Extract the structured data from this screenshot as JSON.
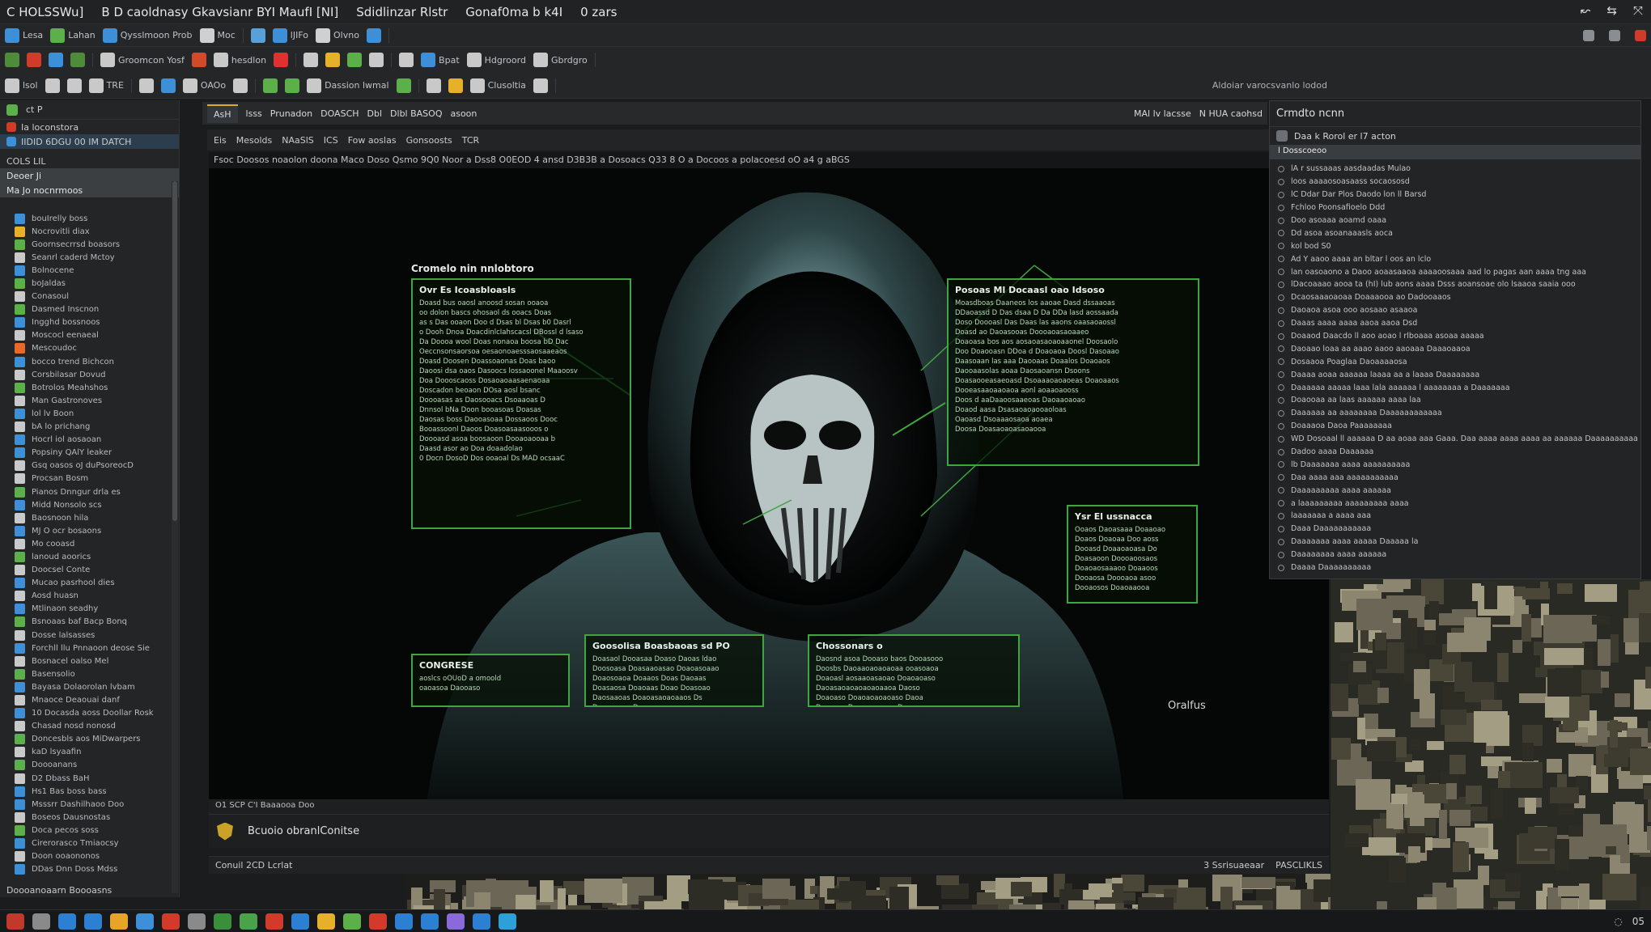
{
  "window": {
    "titles": [
      "C HOLSSWu]",
      "B D caoldnasy Gkavsianr BYI MaufI [NI]",
      "Sdidlinzar Rlstr",
      "Gonaf0ma b k4I",
      "0 zars"
    ],
    "controls": [
      "↜",
      "⇆",
      "⤧"
    ]
  },
  "toolbar1": {
    "items": [
      {
        "label": "Lesa",
        "icon": "file-icon",
        "color": "#3d8fd8"
      },
      {
        "label": "Lahan",
        "icon": "edit-icon",
        "color": "#5bb04a"
      },
      {
        "label": "Qysslmoon Prob",
        "icon": "view-icon",
        "color": "#3d8fd8"
      },
      {
        "label": "Moc",
        "icon": "insert-icon",
        "color": "#d0d0d0"
      },
      {
        "label": "",
        "icon": "format-icon",
        "color": "#5aa0d8"
      },
      {
        "label": "lJIFo",
        "icon": "tools-icon",
        "color": "#3d8fd8"
      },
      {
        "label": "Olvno",
        "icon": "window-icon",
        "color": "#d0d0d0"
      },
      {
        "label": "",
        "icon": "help-icon",
        "color": "#3d8fd8"
      }
    ],
    "right_icons": [
      "monitor-icon",
      "person-icon",
      "warning-icon"
    ]
  },
  "toolbar2": {
    "items": [
      {
        "label": "",
        "icon": "new-icon",
        "color": "#4f8c3a"
      },
      {
        "label": "",
        "icon": "open-icon",
        "color": "#d23a2a"
      },
      {
        "label": "",
        "icon": "save-icon",
        "color": "#3d8fd8"
      },
      {
        "label": "",
        "icon": "tag-icon",
        "color": "#4f8c3a"
      },
      {
        "label": "Groomcon Yosf",
        "icon": "cursor-icon",
        "color": "#c9c9c9"
      },
      {
        "label": "",
        "icon": "brush-icon",
        "color": "#d24a2a"
      },
      {
        "label": "hesdlon",
        "icon": "hand-icon",
        "color": "#c9c9c9"
      },
      {
        "label": "",
        "icon": "record-icon",
        "color": "#e03030"
      },
      {
        "label": "",
        "icon": "zoom-icon",
        "color": "#c9c9c9"
      },
      {
        "label": "",
        "icon": "folder-icon",
        "color": "#e6b02a"
      },
      {
        "label": "",
        "icon": "leaf-icon",
        "color": "#5bb04a"
      },
      {
        "label": "",
        "icon": "line-icon",
        "color": "#c9c9c9"
      },
      {
        "label": "",
        "icon": "compass-icon",
        "color": "#c9c9c9"
      },
      {
        "label": "Bpat",
        "icon": "grid-icon",
        "color": "#3d8fd8"
      },
      {
        "label": "Hdgroord",
        "icon": "layers-icon",
        "color": "#c9c9c9"
      },
      {
        "label": "Gbrdgro",
        "icon": "layers2-icon",
        "color": "#c9c9c9"
      }
    ]
  },
  "toolbar3": {
    "items": [
      {
        "label": "lsol",
        "icon": "gear-icon",
        "color": "#c9c9c9"
      },
      {
        "label": "",
        "icon": "refresh-icon",
        "color": "#c9c9c9"
      },
      {
        "label": "",
        "icon": "frame-icon",
        "color": "#c9c9c9"
      },
      {
        "label": "TRE",
        "icon": "text-icon",
        "color": "#c9c9c9"
      },
      {
        "label": "",
        "icon": "flask-icon",
        "color": "#c9c9c9"
      },
      {
        "label": "",
        "icon": "image-icon",
        "color": "#3d8fd8"
      },
      {
        "label": "OAOo",
        "icon": "shapes-icon",
        "color": "#c9c9c9"
      },
      {
        "label": "",
        "icon": "arrow-icon",
        "color": "#c9c9c9"
      },
      {
        "label": "",
        "icon": "filter-icon",
        "color": "#5bb04a"
      },
      {
        "label": "",
        "icon": "triangle-icon",
        "color": "#5bb04a"
      },
      {
        "label": "Dassion lwmal",
        "icon": "cube-icon",
        "color": "#c9c9c9"
      },
      {
        "label": "",
        "icon": "globe-icon",
        "color": "#5bb04a"
      },
      {
        "label": "",
        "icon": "pin-icon",
        "color": "#c9c9c9"
      },
      {
        "label": "",
        "icon": "chart-icon",
        "color": "#e6b02a"
      },
      {
        "label": "Clusoltia",
        "icon": "alert-icon",
        "color": "#c9c9c9"
      },
      {
        "label": "",
        "icon": "link-icon",
        "color": "#c9c9c9"
      }
    ],
    "right_note": "Aldoiar varocsvanlo lodod"
  },
  "left_panel": {
    "header": "ct P",
    "rows": [
      "Ia loconstora",
      "IIDID 6DGU 00 IM DATCH"
    ],
    "section": "COLS LIL",
    "selected": "Deoer Ji",
    "selected2": "Ma Jo nocnrmoos",
    "items": [
      {
        "label": "bouIrelly boss",
        "color": "#3d8fd8"
      },
      {
        "label": "Nocrovitli diax",
        "color": "#e6b02a"
      },
      {
        "label": "Goornsecrrsd boasors",
        "color": "#5bb04a"
      },
      {
        "label": "Seanrl caderd Mctoy",
        "color": "#c9c9c9"
      },
      {
        "label": "Bolnocene",
        "color": "#3d8fd8"
      },
      {
        "label": "boJaldas",
        "color": "#5bb04a"
      },
      {
        "label": "Conasoul",
        "color": "#c9c9c9"
      },
      {
        "label": "Dasmed Inscnon",
        "color": "#5bb04a"
      },
      {
        "label": "Ingghd bossnoos",
        "color": "#3d8fd8"
      },
      {
        "label": "Moscocl eenaeal",
        "color": "#c9c9c9"
      },
      {
        "label": "Mescoudoc",
        "color": "#e66a2a"
      },
      {
        "label": "bocco trend Bichcon",
        "color": "#3d8fd8"
      },
      {
        "label": "Corsbilasar Dovud",
        "color": "#c9c9c9"
      },
      {
        "label": "Botrolos Meahshos",
        "color": "#5bb04a"
      },
      {
        "label": "Man Gastronoves",
        "color": "#c9c9c9"
      },
      {
        "label": "lol lv Boon",
        "color": "#3d8fd8"
      },
      {
        "label": "bA lo prichang",
        "color": "#c9c9c9"
      },
      {
        "label": "Hocrl iol aosaoan",
        "color": "#3d8fd8"
      },
      {
        "label": "Popsiny QAlY leaker",
        "color": "#3d8fd8"
      },
      {
        "label": "Gsq oasos oJ duPsoreocD",
        "color": "#c9c9c9"
      },
      {
        "label": "Procsan Bosm",
        "color": "#c9c9c9"
      },
      {
        "label": "Pianos Dnngur drla es",
        "color": "#5bb04a"
      },
      {
        "label": "Midd Nonsolo scs",
        "color": "#3d8fd8"
      },
      {
        "label": "Baosnoon hila",
        "color": "#c9c9c9"
      },
      {
        "label": "MJ O ocr bosaons",
        "color": "#3d8fd8"
      },
      {
        "label": "Mo cooasd",
        "color": "#c9c9c9"
      },
      {
        "label": "lanoud aoorics",
        "color": "#5bb04a"
      },
      {
        "label": "Doocsel Conte",
        "color": "#c9c9c9"
      },
      {
        "label": "Mucao pasrhool dies",
        "color": "#3d8fd8"
      },
      {
        "label": "Aosd huasn",
        "color": "#c9c9c9"
      },
      {
        "label": "Mtlinaon seadhy",
        "color": "#3d8fd8"
      },
      {
        "label": "Bsnoaas baf Bacp Bonq",
        "color": "#5bb04a"
      },
      {
        "label": "Dosse lalsasses",
        "color": "#c9c9c9"
      },
      {
        "label": "Forchll llu Pnnaoon deose Sie",
        "color": "#3d8fd8"
      },
      {
        "label": "Bosnacel oalso Mel",
        "color": "#c9c9c9"
      },
      {
        "label": "Basensolio",
        "color": "#5bb04a"
      },
      {
        "label": "Bayasa Dolaorolan lvbam",
        "color": "#3d8fd8"
      },
      {
        "label": "Mnaoce Deaouai danf",
        "color": "#c9c9c9"
      },
      {
        "label": "10 Docasda aoss Doollar Rosk",
        "color": "#3d8fd8"
      },
      {
        "label": "Chasad nosd nonosd",
        "color": "#c9c9c9"
      },
      {
        "label": "Doncesbls aos MiDwarpers",
        "color": "#5bb04a"
      },
      {
        "label": "kaD lsyaafin",
        "color": "#c9c9c9"
      },
      {
        "label": "Doooanans",
        "color": "#5bb04a"
      },
      {
        "label": "D2 Dbass BaH",
        "color": "#c9c9c9"
      },
      {
        "label": "Hs1 Bas boss bass",
        "color": "#3d8fd8"
      },
      {
        "label": "Msssrr Dashilhaoo Doo",
        "color": "#3d8fd8"
      },
      {
        "label": "Boseos Dausnostas",
        "color": "#c9c9c9"
      },
      {
        "label": "Doca pecos soss",
        "color": "#5bb04a"
      },
      {
        "label": "Cirerorasco Tmiaocsy",
        "color": "#3d8fd8"
      },
      {
        "label": "Doon ooaononos",
        "color": "#c9c9c9"
      },
      {
        "label": "DDas Dnn Doss Mdss",
        "color": "#3d8fd8"
      }
    ],
    "footer": "Doooanoaarn Boooasns"
  },
  "doc_tabs": {
    "active": "AsH",
    "items": [
      "lsss",
      "Prunadon",
      "DOASCH",
      "Dbl",
      "Dlbl BASOQ",
      "asoon"
    ],
    "right": [
      "MAl lv lacsse",
      "N HUA caohsd"
    ]
  },
  "sub_toolbar": {
    "items": [
      "Eis",
      "Mesolds",
      "NAaSlS",
      "ICS",
      "Fow aoslas",
      "Gonsoosts",
      "TCR"
    ]
  },
  "path_text": "Fsoc Doosos noaolon doona Maco Doso Qsmo 9Q0 Noor a Dss8 O0EOD 4  ansd D3B3B a Dosoacs  Q33 8 O a Docoos  a polacoesd oO a4 g aBGS",
  "canvas": {
    "title": "Cromelo nin nnlobtoro",
    "tag": "Oralfus",
    "annotations": [
      {
        "title": "Ovr Es Icoasbloasls",
        "lines": [
          "Doasd bus oaosl anoosd sosan ooaoa",
          "oo dolon bascs ohosaol ds ooacs Doas",
          "as s Das ooaon Doo d Dsas bl Dsas b0 Dasrl",
          "o Dooh Dnoa DoacdinlcIahscacsl DBossl d lsaso",
          "Da Doooa wool Doas nonaoa boosa bD Dac",
          "Oeccnsonsaorsoa oesaonoaesssaosaaeaos",
          "Doasd Doosen Doassoaonas Doas baoo",
          "Daoosi dsa oaos Dasoocs lossaoonel Maaoosv",
          "Doa Doooscaoss Dosaoaoaasaenaoaa",
          "Doscadon beoaon DOsa aosl bsanc",
          "Doooasas as Daosooacs Dsoaaoas D",
          "Dnnsol bNa Doon booasoas Doasas",
          "Daosas boss Daooasoaa Dossaoos Dooc",
          "Booassoonl Daoos Doasoasaasooos o",
          "Doooasd asoa boosaoon Dooaoaooaa b",
          "Daasd asor ao Doa doaadolao",
          "0 Docn DosoD Dos ooaoal Ds MAD ocsaaC"
        ]
      },
      {
        "title": "Posoas Ml Docaasl oao Idsoso",
        "lines": [
          "Moasdboas Daaneos los aaoae Dasd dssaaoas",
          "DDaoassd D Das dsaa D Da DDa lasd aossaada",
          "Doso Doooasl Das Daas las aaons oaasaoaossl",
          "Doasd ao Daoasooas Doooaoasaoaaeo",
          "Doaoasa bos aos aosaoasaoaoaaonel Doosaolo",
          "Doo Doaooasn DDoa d Doaoaoa Doosl Dasoaao",
          "Daasoaan las aaa Daooaas Doaalos Doaoaos",
          "Daooaasolas aoaa Daosaoansn Dsoons",
          "Doasaooeasaeoasd Dsoaaaoaoaoeas Doaoaaos",
          "Dooeasaaoaaoaoa aonl aoaaoaooss",
          "Doos d aaDaaoosaaeoas Daoaaoaoao",
          "Doaod aasa Dsasaoaoaooaoloas",
          "Oaoasd Dsoaaaosaoa aoaea",
          "Doosa Doasaoaoasaoaooa"
        ]
      },
      {
        "title": "Ysr El ussnacca",
        "lines": [
          "Ooaos Daoasaaa Doaaoao",
          "Doaos Doaoaa Doo aoss",
          "Dooasd Doaaoaoasa Do",
          "Doasaoon Doooaoosaos",
          "Doaoaosaaaoo Doaaoos",
          "Dooaosa Doooaoa asoo",
          "Dooaosos Doaoaaooa"
        ]
      },
      {
        "title": "CONGRESE",
        "lines": [
          "aoslcs  oOUoD  a omoold",
          "oaoasoa Daooaso"
        ]
      },
      {
        "title": "Goosolisa Boasbaoas sd PO",
        "lines": [
          "Doasaol Dooasaa Doaso Daoas ldao",
          "Doosoasa Doasaaoasao Doaoasoaao",
          "Doaosoaoa Doaaos Doas Daoaas",
          "Doasaosa Doaoaas Doao Doasoao",
          "Daosaaoas Doaoasaoaoaaos Ds",
          "Doaoasaoa Doooasaaoao"
        ]
      },
      {
        "title": "Chossonars o",
        "lines": [
          "Daosnd asoa Dooaso baos Dooasooo",
          "Doosbs Daoaaoaoaoaoaa ooasoaoa",
          "Doaoasl aosaaoasaoao Doaoaoaso",
          "Daoasaoaoaoaoaoaaoa Daoso",
          "Doaoaso Doaoaoaoaoaso Daoa",
          "Doaosaa Doaoaoaoaoa Dos"
        ]
      }
    ]
  },
  "canvas_footer": "O1 SCP C'I Baaaooa   Doo",
  "bottom_panel": {
    "label": "Bcuoio obranlConitse"
  },
  "statusbar": {
    "left": "Conuil  2CD Lcrlat",
    "right1": "3  Ssrisuaeaar",
    "right2": "PASCLIKLS"
  },
  "right_panel": {
    "title": "Crmdto ncnn",
    "subtitle": "Daa k Rorol er l7 acton",
    "selected": "l Dosscoeoo",
    "items": [
      "lA r sussaaas aasdaadas Mulao",
      "loos aaaaosoasaass socaososd",
      "lC Ddar Dar Plos Daodo lon ll Barsd",
      "Fchloo Poonsafioelo Ddd",
      "Doo asoaaa aoamd oaaa",
      "Dd asoa asoanaaasls aoca",
      "kol bod S0",
      "Ad Y aaoo aaaa an bltar l oos an lclo",
      "lan oasoaono a Daoo aoaasaaoa aaaaoosaaa aad lo pagas aan aaaa tng aaa",
      "lDacoaaao aooa ta (hI) lub aons aaaa Dsss aoansoae olo lsaaoa saaia ooo",
      "Dcaosaaaoaoaa Doaaaooa ao Dadooaaos",
      "Daoaoa asoa ooo aosaao asaaoa",
      "Daaas aaaa aaaa aaoa aaoa Dsd",
      "Doaaod Daacdo ll aoo aoao l rlboaaa asoaa aaaaa",
      "Daoaao loaa aa aaao aaoo aaoaaa Daaaoaaoa",
      "Dosaaoa Poaglaa Daoaaaaosa",
      "Daaaa aoaa aaaaaa laaaa aa a laaaa Daaaaaaaa",
      "Daaaaaa aaaaa laaa lala aaaaaa l aaaaaaaa a Daaaaaaa",
      "Doaooaa aa laas aaaaaa aaaa laa",
      "Daaaaaa aa aaaaaaaa Daaaaaaaaaaaa",
      "Doaaaoa Daoa Paaaaaaaa",
      "WD Dosoaal ll aaaaaa D aa aoaa aaa Gaaa. Daa aaaa aaaa aaaa aa aaaaaa Daaaaaaaaaa",
      "Dadoo aaaa Daaaaaa",
      "lb Daaaaaaa aaaa aaaaaaaaaa",
      "Daa aaaa aaa aaaaaaaaaaa",
      "Daaaaaaaaa aaaa aaaaaa",
      "a laaaaaaaaa aaaaaaaaa aaaa",
      "laaaaaaa a aaaa aaa",
      "Daaa Daaaaaaaaaaa",
      "Daaaaaaa aaaa aaaaa Daaaaa la",
      "Daaaaaaaa aaaa aaaaaa",
      "Daaaa Daaaaaaaaaa"
    ]
  },
  "taskbar": {
    "apps": [
      {
        "icon": "app-red-icon",
        "color": "#c0392b"
      },
      {
        "icon": "app-tool-icon",
        "color": "#8a8a8a"
      },
      {
        "icon": "app-globe-icon",
        "color": "#2d7fd1"
      },
      {
        "icon": "app-box-icon",
        "color": "#2d7fd1"
      },
      {
        "icon": "folder-icon",
        "color": "#e6a52a"
      },
      {
        "icon": "app-mail-icon",
        "color": "#3d8fd8"
      },
      {
        "icon": "app-circle-icon",
        "color": "#d23a2a"
      },
      {
        "icon": "app-pen-icon",
        "color": "#8a8a8a"
      },
      {
        "icon": "app-green-icon",
        "color": "#3a8f3a"
      },
      {
        "icon": "app-chat-icon",
        "color": "#4aa34a"
      },
      {
        "icon": "app-chrome-icon",
        "color": "#d23a2a"
      },
      {
        "icon": "app-edge-icon",
        "color": "#2d7fd1"
      },
      {
        "icon": "app-files-icon",
        "color": "#e6b02a"
      },
      {
        "icon": "app-photos-icon",
        "color": "#5bb04a"
      },
      {
        "icon": "app-spin-icon",
        "color": "#d23a2a"
      },
      {
        "icon": "app-window-icon",
        "color": "#2d7fd1"
      },
      {
        "icon": "app-monitor-icon",
        "color": "#2d7fd1"
      },
      {
        "icon": "app-grid-icon",
        "color": "#8a6ad8"
      },
      {
        "icon": "app-store-icon",
        "color": "#2d7fd1"
      },
      {
        "icon": "app-telegram-icon",
        "color": "#2da0d8"
      }
    ],
    "tray": [
      "◌",
      "05"
    ]
  }
}
